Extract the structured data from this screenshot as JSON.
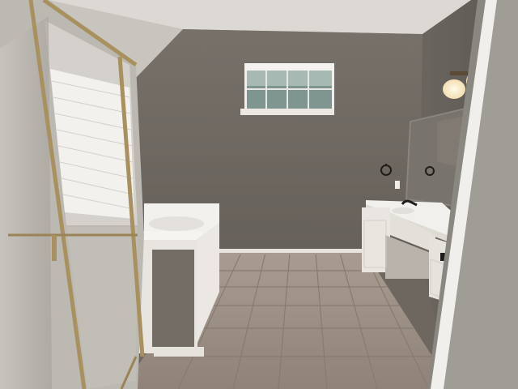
{
  "scene": {
    "colors": {
      "ceiling": "#d9d6d1",
      "back_wall": "#6f6961",
      "right_wall": "#65605a",
      "floor": "#a2958a",
      "grout": "#8a7e74",
      "cabinet": "#ece9e4",
      "tub": "#f4f2ee",
      "window_glass": "#8fa19c",
      "shower_frame": "#a8915e",
      "lamp_glow": "#fff7e0"
    }
  }
}
